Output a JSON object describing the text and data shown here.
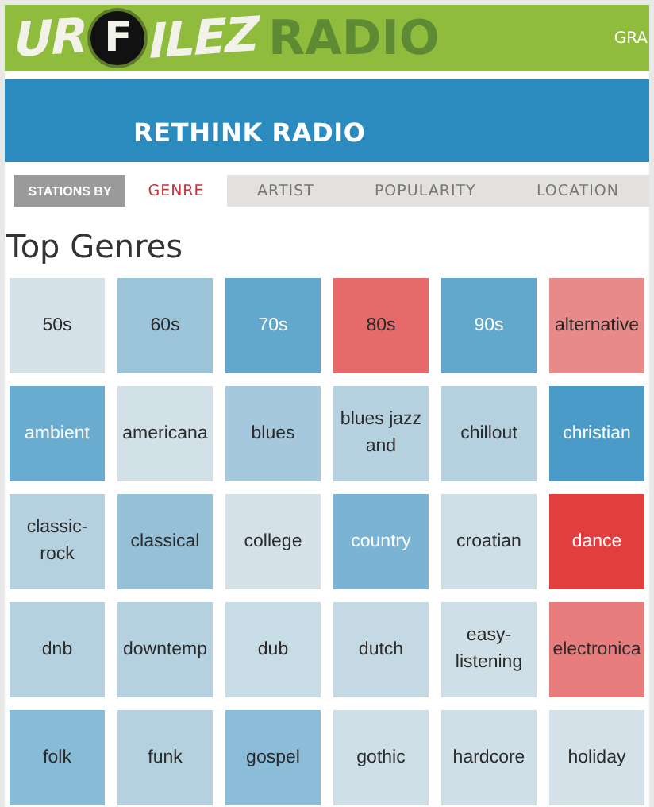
{
  "header": {
    "logo": {
      "lead": "UR",
      "circled": "F",
      "tail": "ILEZ",
      "suffix": "RADIO"
    },
    "nav_item": "GRA"
  },
  "banner": {
    "title": "RETHINK RADIO"
  },
  "tabs": {
    "label": "STATIONS BY",
    "items": [
      {
        "label": "GENRE",
        "selected": true
      },
      {
        "label": "ARTIST",
        "selected": false
      },
      {
        "label": "POPULARITY",
        "selected": false
      },
      {
        "label": "LOCATION",
        "selected": false
      }
    ]
  },
  "heading": "Top Genres",
  "genres": [
    {
      "label": "50s",
      "color": "#d5e1e8"
    },
    {
      "label": "60s",
      "color": "#9cc4d9"
    },
    {
      "label": "70s",
      "color": "#62a8cc"
    },
    {
      "label": "80s",
      "color": "#e66a6a"
    },
    {
      "label": "90s",
      "color": "#62a8cc"
    },
    {
      "label": "alternative",
      "color": "#e88a8a"
    },
    {
      "label": "ambient",
      "color": "#6aacd0"
    },
    {
      "label": "americana",
      "color": "#d2e0e8"
    },
    {
      "label": "blues",
      "color": "#a5c8dc"
    },
    {
      "label": "blues jazz\nand",
      "color": "#b5d1e0"
    },
    {
      "label": "chillout",
      "color": "#b5d1e0"
    },
    {
      "label": "christian",
      "color": "#4a9bc8"
    },
    {
      "label": "classic-\nrock",
      "color": "#b5d1e0"
    },
    {
      "label": "classical",
      "color": "#95c0d8"
    },
    {
      "label": "college",
      "color": "#d5e1e8"
    },
    {
      "label": "country",
      "color": "#7ab3d3"
    },
    {
      "label": "croatian",
      "color": "#cfdfe7"
    },
    {
      "label": "dance",
      "color": "#e23e3e"
    },
    {
      "label": "dnb",
      "color": "#b5d1e0"
    },
    {
      "label": "downtemp",
      "color": "#b5d1e0"
    },
    {
      "label": "dub",
      "color": "#c8dce6"
    },
    {
      "label": "dutch",
      "color": "#c4d9e4"
    },
    {
      "label": "easy-\nlistening",
      "color": "#cfdfe7"
    },
    {
      "label": "electronica",
      "color": "#e67c7c"
    },
    {
      "label": "folk",
      "color": "#88bcd6"
    },
    {
      "label": "funk",
      "color": "#b5d1e0"
    },
    {
      "label": "gospel",
      "color": "#8bbdd8"
    },
    {
      "label": "gothic",
      "color": "#cfdfe7"
    },
    {
      "label": "hardcore",
      "color": "#cfdfe7"
    },
    {
      "label": "holiday",
      "color": "#d5e1e8"
    }
  ]
}
